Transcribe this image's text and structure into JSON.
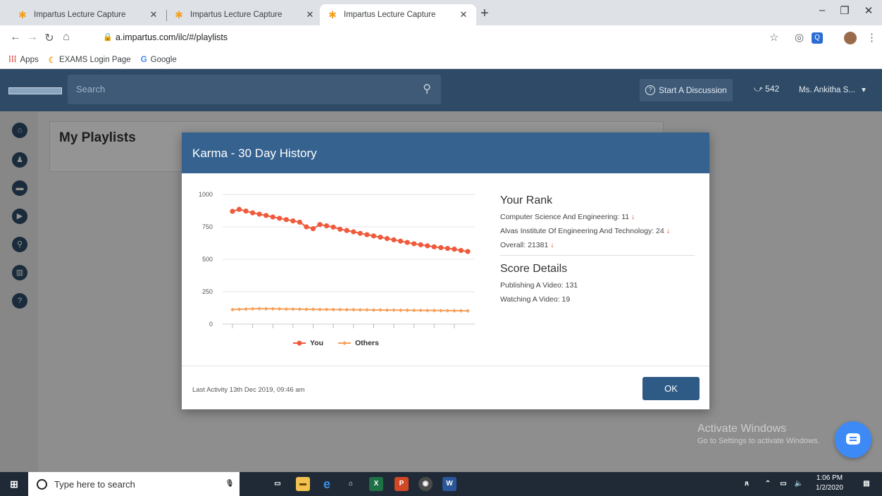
{
  "browser": {
    "tabs": [
      {
        "title": "Impartus Lecture Capture",
        "active": false
      },
      {
        "title": "Impartus Lecture Capture",
        "active": false
      },
      {
        "title": "Impartus Lecture Capture",
        "active": true
      }
    ],
    "url": "a.impartus.com/ilc/#/playlists",
    "bookmarks": [
      "Apps",
      "EXAMS Login Page",
      "Google"
    ]
  },
  "header": {
    "search_placeholder": "Search",
    "discussion_label": "Start A Discussion",
    "karma_count": "542",
    "user_name": "Ms. Ankitha S..."
  },
  "page": {
    "title": "My Playlists"
  },
  "modal": {
    "title": "Karma - 30 Day History",
    "rank_heading": "Your Rank",
    "ranks": [
      "Computer Science And Engineering: 11",
      "Alvas Institute Of Engineering And Technology: 24",
      "Overall: 21381"
    ],
    "score_heading": "Score Details",
    "scores": [
      "Publishing A Video: 131",
      "Watching A Video: 19"
    ],
    "last_activity": "Last Activity 13th Dec 2019, 09:46 am",
    "ok_label": "OK"
  },
  "chart_data": {
    "type": "line",
    "title": "",
    "xlabel": "",
    "ylabel": "",
    "ylim": [
      0,
      1000
    ],
    "yticks": [
      0,
      250,
      500,
      750,
      1000
    ],
    "legend_position": "bottom",
    "series": [
      {
        "name": "You",
        "color": "#ef5a3c",
        "marker": "circle",
        "values": [
          870,
          885,
          872,
          858,
          848,
          838,
          826,
          816,
          806,
          796,
          786,
          750,
          736,
          768,
          758,
          748,
          732,
          722,
          712,
          700,
          690,
          680,
          670,
          660,
          650,
          640,
          630,
          620,
          612,
          604,
          596,
          590,
          584,
          578,
          568,
          560
        ]
      },
      {
        "name": "Others",
        "color": "#f5a05a",
        "marker": "diamond",
        "values": [
          112,
          114,
          116,
          118,
          119,
          118,
          118,
          117,
          116,
          116,
          115,
          114,
          114,
          113,
          113,
          112,
          112,
          111,
          111,
          110,
          110,
          109,
          109,
          108,
          108,
          107,
          107,
          106,
          106,
          105,
          105,
          104,
          104,
          103,
          103,
          102
        ]
      }
    ]
  },
  "system": {
    "taskbar_search": "Type here to search",
    "time": "1:06 PM",
    "date": "1/2/2020",
    "activate_title": "Activate Windows",
    "activate_sub": "Go to Settings to activate Windows."
  }
}
